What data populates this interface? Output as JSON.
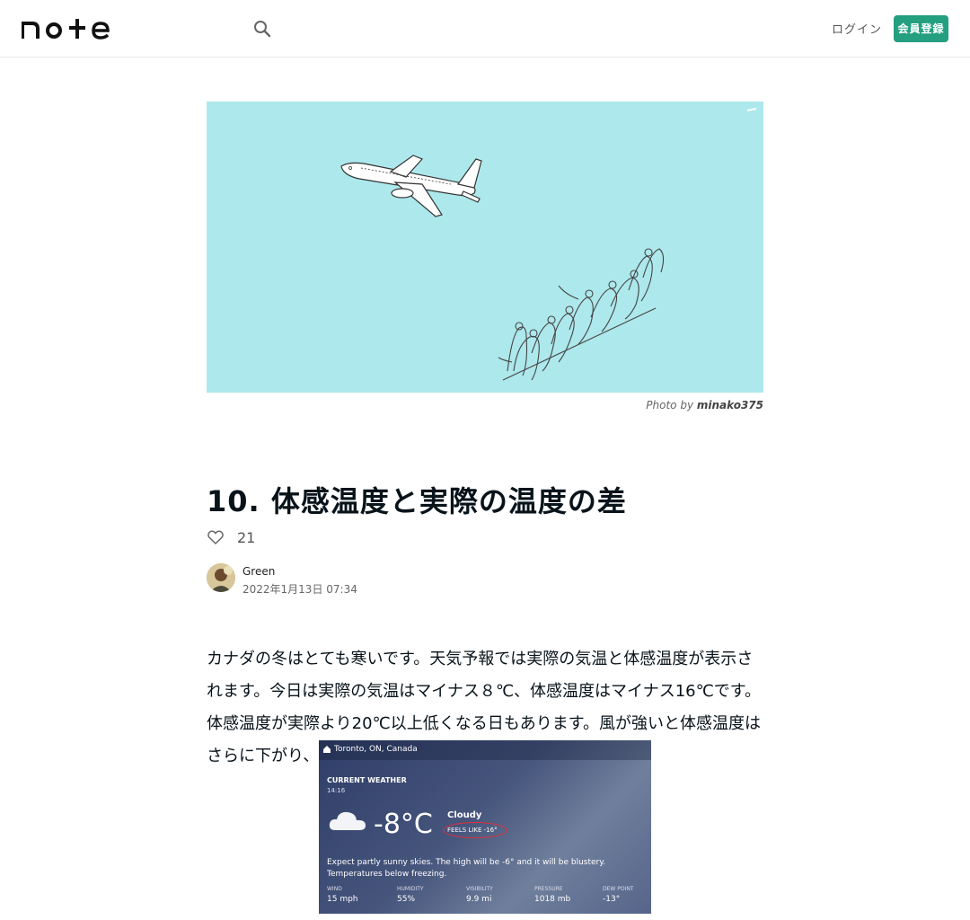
{
  "header": {
    "logo_text": "note",
    "login_label": "ログイン",
    "signup_label": "会員登録",
    "accent_color": "#249f80"
  },
  "hero": {
    "caption_prefix": "Photo by",
    "caption_author": "minako375",
    "background_color": "#ade8ec"
  },
  "article": {
    "title": "10. 体感温度と実際の温度の差",
    "like_count": "21",
    "author_name": "Green",
    "published": "2022年1月13日 07:34",
    "paragraph": "カナダの冬はとても寒いです。天気予報では実際の気温と体感温度が表示されます。今日は実際の気温はマイナス８℃、体感温度はマイナス16℃です。体感温度が実際より20℃以上低くなる日もあります。風が強いと体感温度はさらに下がり、外に出るのが大変です。"
  },
  "weather": {
    "location": "Toronto, ON, Canada",
    "heading": "CURRENT WEATHER",
    "time": "14:16",
    "temperature": "-8°C",
    "condition": "Cloudy",
    "feels_like": "FEELS LIKE  -16°",
    "description": "Expect partly sunny skies. The high will be -6° and it will be blustery. Temperatures below freezing.",
    "stats": [
      {
        "label": "WIND",
        "value": "15 mph"
      },
      {
        "label": "HUMIDITY",
        "value": "55%"
      },
      {
        "label": "VISIBILITY",
        "value": "9.9 mi"
      },
      {
        "label": "PRESSURE",
        "value": "1018 mb"
      },
      {
        "label": "DEW POINT",
        "value": "-13°"
      }
    ]
  }
}
